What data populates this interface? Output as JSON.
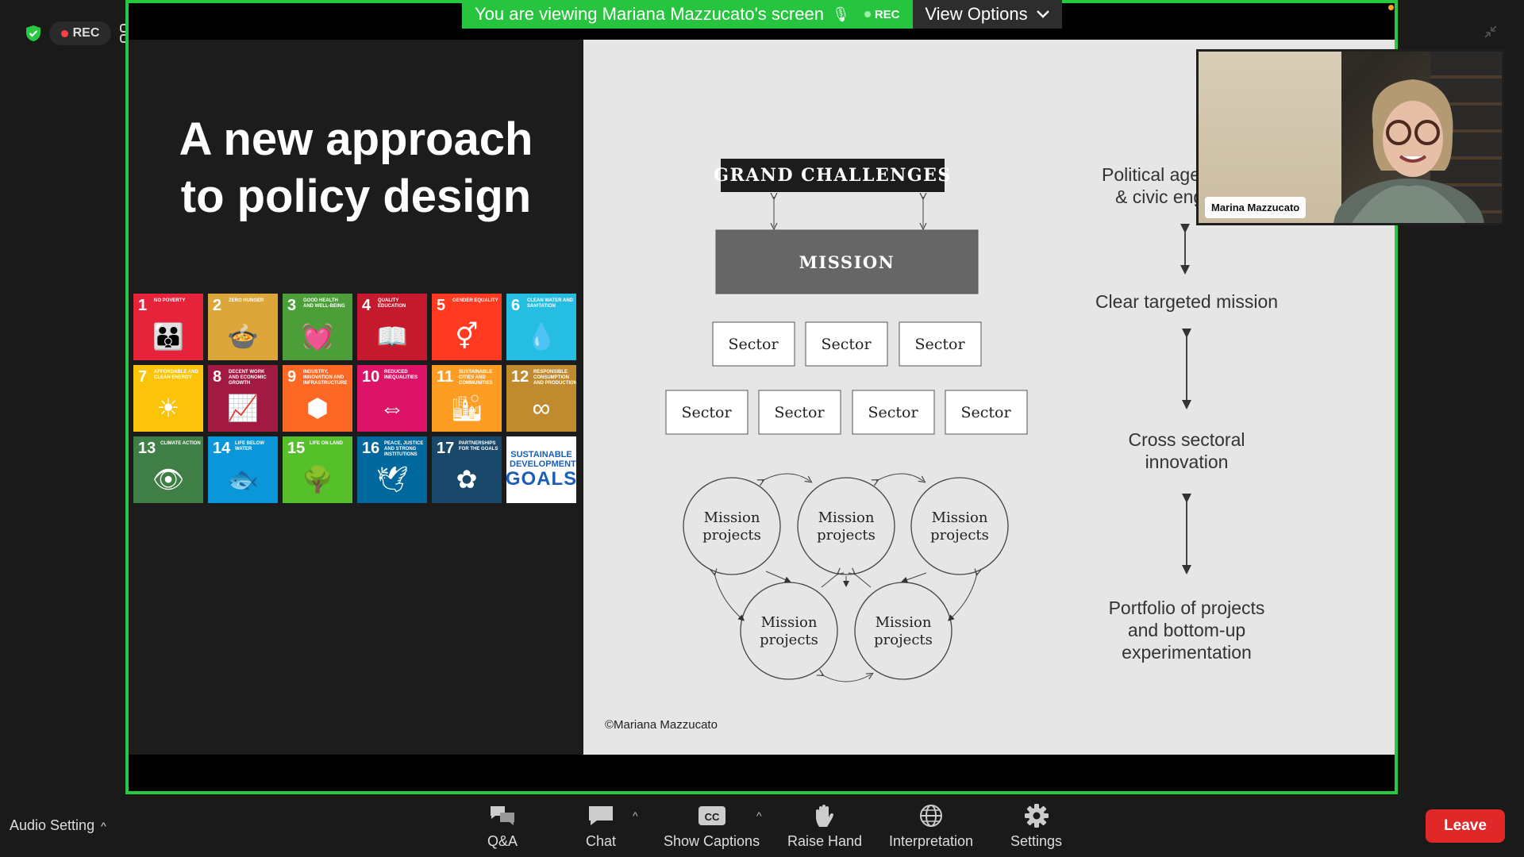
{
  "status": {
    "rec_label": "REC"
  },
  "banner": {
    "text": "You are viewing Mariana Mazzucato's screen",
    "rec_label": "REC",
    "view_options": "View Options"
  },
  "slide": {
    "title_line1": "A new approach",
    "title_line2": "to policy design",
    "sdg_tiles": [
      {
        "num": "1",
        "label": "No Poverty",
        "color": "#e5243b"
      },
      {
        "num": "2",
        "label": "Zero Hunger",
        "color": "#dda63a"
      },
      {
        "num": "3",
        "label": "Good Health and Well-Being",
        "color": "#4c9f38"
      },
      {
        "num": "4",
        "label": "Quality Education",
        "color": "#c5192d"
      },
      {
        "num": "5",
        "label": "Gender Equality",
        "color": "#ff3a21"
      },
      {
        "num": "6",
        "label": "Clean Water and Sanitation",
        "color": "#26bde2"
      },
      {
        "num": "7",
        "label": "Affordable and Clean Energy",
        "color": "#fcc30b"
      },
      {
        "num": "8",
        "label": "Decent Work and Economic Growth",
        "color": "#a21942"
      },
      {
        "num": "9",
        "label": "Industry, Innovation and Infrastructure",
        "color": "#fd6925"
      },
      {
        "num": "10",
        "label": "Reduced Inequalities",
        "color": "#dd1367"
      },
      {
        "num": "11",
        "label": "Sustainable Cities and Communities",
        "color": "#fd9d24"
      },
      {
        "num": "12",
        "label": "Responsible Consumption and Production",
        "color": "#bf8b2e"
      },
      {
        "num": "13",
        "label": "Climate Action",
        "color": "#3f7e44"
      },
      {
        "num": "14",
        "label": "Life Below Water",
        "color": "#0a97d9"
      },
      {
        "num": "15",
        "label": "Life On Land",
        "color": "#56c02b"
      },
      {
        "num": "16",
        "label": "Peace, Justice and Strong Institutions",
        "color": "#00689d"
      },
      {
        "num": "17",
        "label": "Partnerships for the Goals",
        "color": "#19486a"
      }
    ],
    "sdg_goals_top": "SUSTAINABLE DEVELOPMENT",
    "sdg_goals_big": "GOALS",
    "grand_challenges": "GRAND CHALLENGES",
    "mission": "MISSION",
    "sector": "Sector",
    "mission_projects_line1": "Mission",
    "mission_projects_line2": "projects",
    "side_labels": {
      "political_1": "Political agen",
      "political_2": "& civic enga",
      "clear": "Clear targeted mission",
      "cross_1": "Cross sectoral",
      "cross_2": "innovation",
      "portfolio_1": "Portfolio of projects",
      "portfolio_2": "and bottom-up",
      "portfolio_3": "experimentation"
    },
    "copyright": "©Mariana Mazzucato"
  },
  "webcam": {
    "name": "Marina Mazzucato"
  },
  "toolbar": {
    "audio_setting": "Audio Setting",
    "qa": "Q&A",
    "chat": "Chat",
    "captions": "Show Captions",
    "raise_hand": "Raise Hand",
    "interpretation": "Interpretation",
    "settings": "Settings",
    "leave": "Leave",
    "cc": "CC"
  },
  "colors": {
    "share_border": "#27c93f",
    "leave": "#e02828"
  }
}
